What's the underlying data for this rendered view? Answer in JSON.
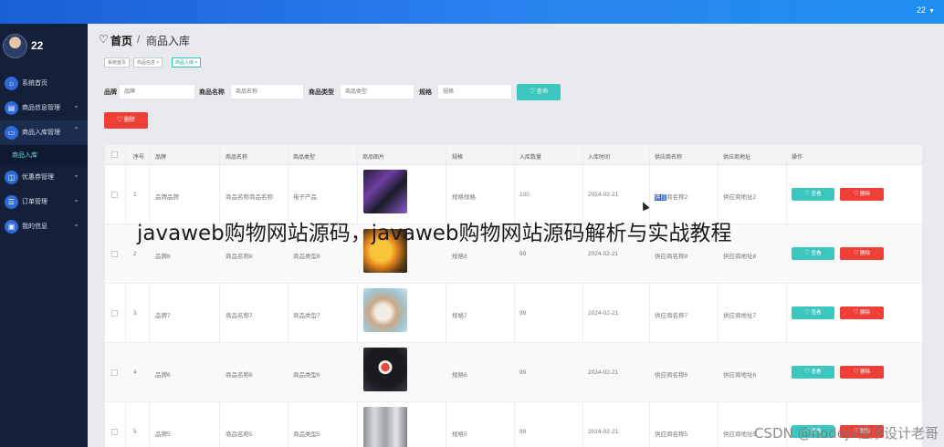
{
  "topbar": {
    "user": "22",
    "caret": "▼"
  },
  "sidebar": {
    "username": "22",
    "items": [
      {
        "label": "系统首页",
        "icon": "home-icon",
        "arrow": ""
      },
      {
        "label": "商品信息管理",
        "icon": "box-icon",
        "arrow": "⌄"
      },
      {
        "label": "商品入库管理",
        "icon": "inbox-icon",
        "arrow": "⌃"
      },
      {
        "label": "商品入库",
        "icon": "",
        "arrow": ""
      },
      {
        "label": "优惠券管理",
        "icon": "ticket-icon",
        "arrow": "⌄"
      },
      {
        "label": "订单管理",
        "icon": "order-icon",
        "arrow": "⌄"
      },
      {
        "label": "我的信息",
        "icon": "user-info-icon",
        "arrow": "⌄"
      }
    ]
  },
  "breadcrumb": {
    "home": "首页",
    "sep": "/",
    "current": "商品入库"
  },
  "tags": [
    "系统首页",
    "商品信息 ×",
    "商品入库 ×"
  ],
  "search": {
    "brand_label": "品牌",
    "brand_placeholder": "品牌",
    "name_label": "商品名称",
    "name_placeholder": "商品名称",
    "type_label": "商品类型",
    "type_placeholder": "商品类型",
    "spec_label": "规格",
    "spec_placeholder": "规格",
    "query_label": "♡ 查询"
  },
  "toolbar": {
    "delete_label": "♡ 删除"
  },
  "table": {
    "headers": [
      "序号",
      "品牌",
      "商品名称",
      "商品类型",
      "商品图片",
      "规格",
      "入库数量",
      "入库时间",
      "供应商名称",
      "供应商地址",
      "操作"
    ],
    "view_label": "♡ 查看",
    "delete_label": "♡ 删除",
    "rows": [
      {
        "no": "1",
        "brand": "品牌品牌",
        "name": "商品名称商品名称",
        "type": "电子产品",
        "spec": "规格规格",
        "qty": "100",
        "date": "2024-02-21",
        "supplier_hl": "供应",
        "supplier_rest": "商名称2",
        "address": "供应商地址2"
      },
      {
        "no": "2",
        "brand": "品牌8",
        "name": "商品名称8",
        "type": "商品类型8",
        "spec": "规格8",
        "qty": "99",
        "date": "2024-02-21",
        "supplier_hl": "",
        "supplier_rest": "供应商名称8",
        "address": "供应商地址8"
      },
      {
        "no": "3",
        "brand": "品牌7",
        "name": "商品名称7",
        "type": "商品类型7",
        "spec": "规格7",
        "qty": "99",
        "date": "2024-02-21",
        "supplier_hl": "",
        "supplier_rest": "供应商名称7",
        "address": "供应商地址7"
      },
      {
        "no": "4",
        "brand": "品牌6",
        "name": "商品名称6",
        "type": "商品类型6",
        "spec": "规格6",
        "qty": "99",
        "date": "2024-02-21",
        "supplier_hl": "",
        "supplier_rest": "供应商名称6",
        "address": "供应商地址6"
      },
      {
        "no": "5",
        "brand": "品牌5",
        "name": "商品名称5",
        "type": "商品类型5",
        "spec": "规格5",
        "qty": "99",
        "date": "2024-02-21",
        "supplier_hl": "",
        "supplier_rest": "供应商名称5",
        "address": "供应商地址5"
      }
    ]
  },
  "overlay_title": "javaweb购物网站源码，javaweb购物网站源码解析与实战教程",
  "watermark": "CSDN @nodejs程序设计老哥",
  "colors": {
    "sidebar": "#14203a",
    "topbar": "#2b86f0",
    "teal": "#3cc6c0",
    "red": "#ef3f36"
  }
}
